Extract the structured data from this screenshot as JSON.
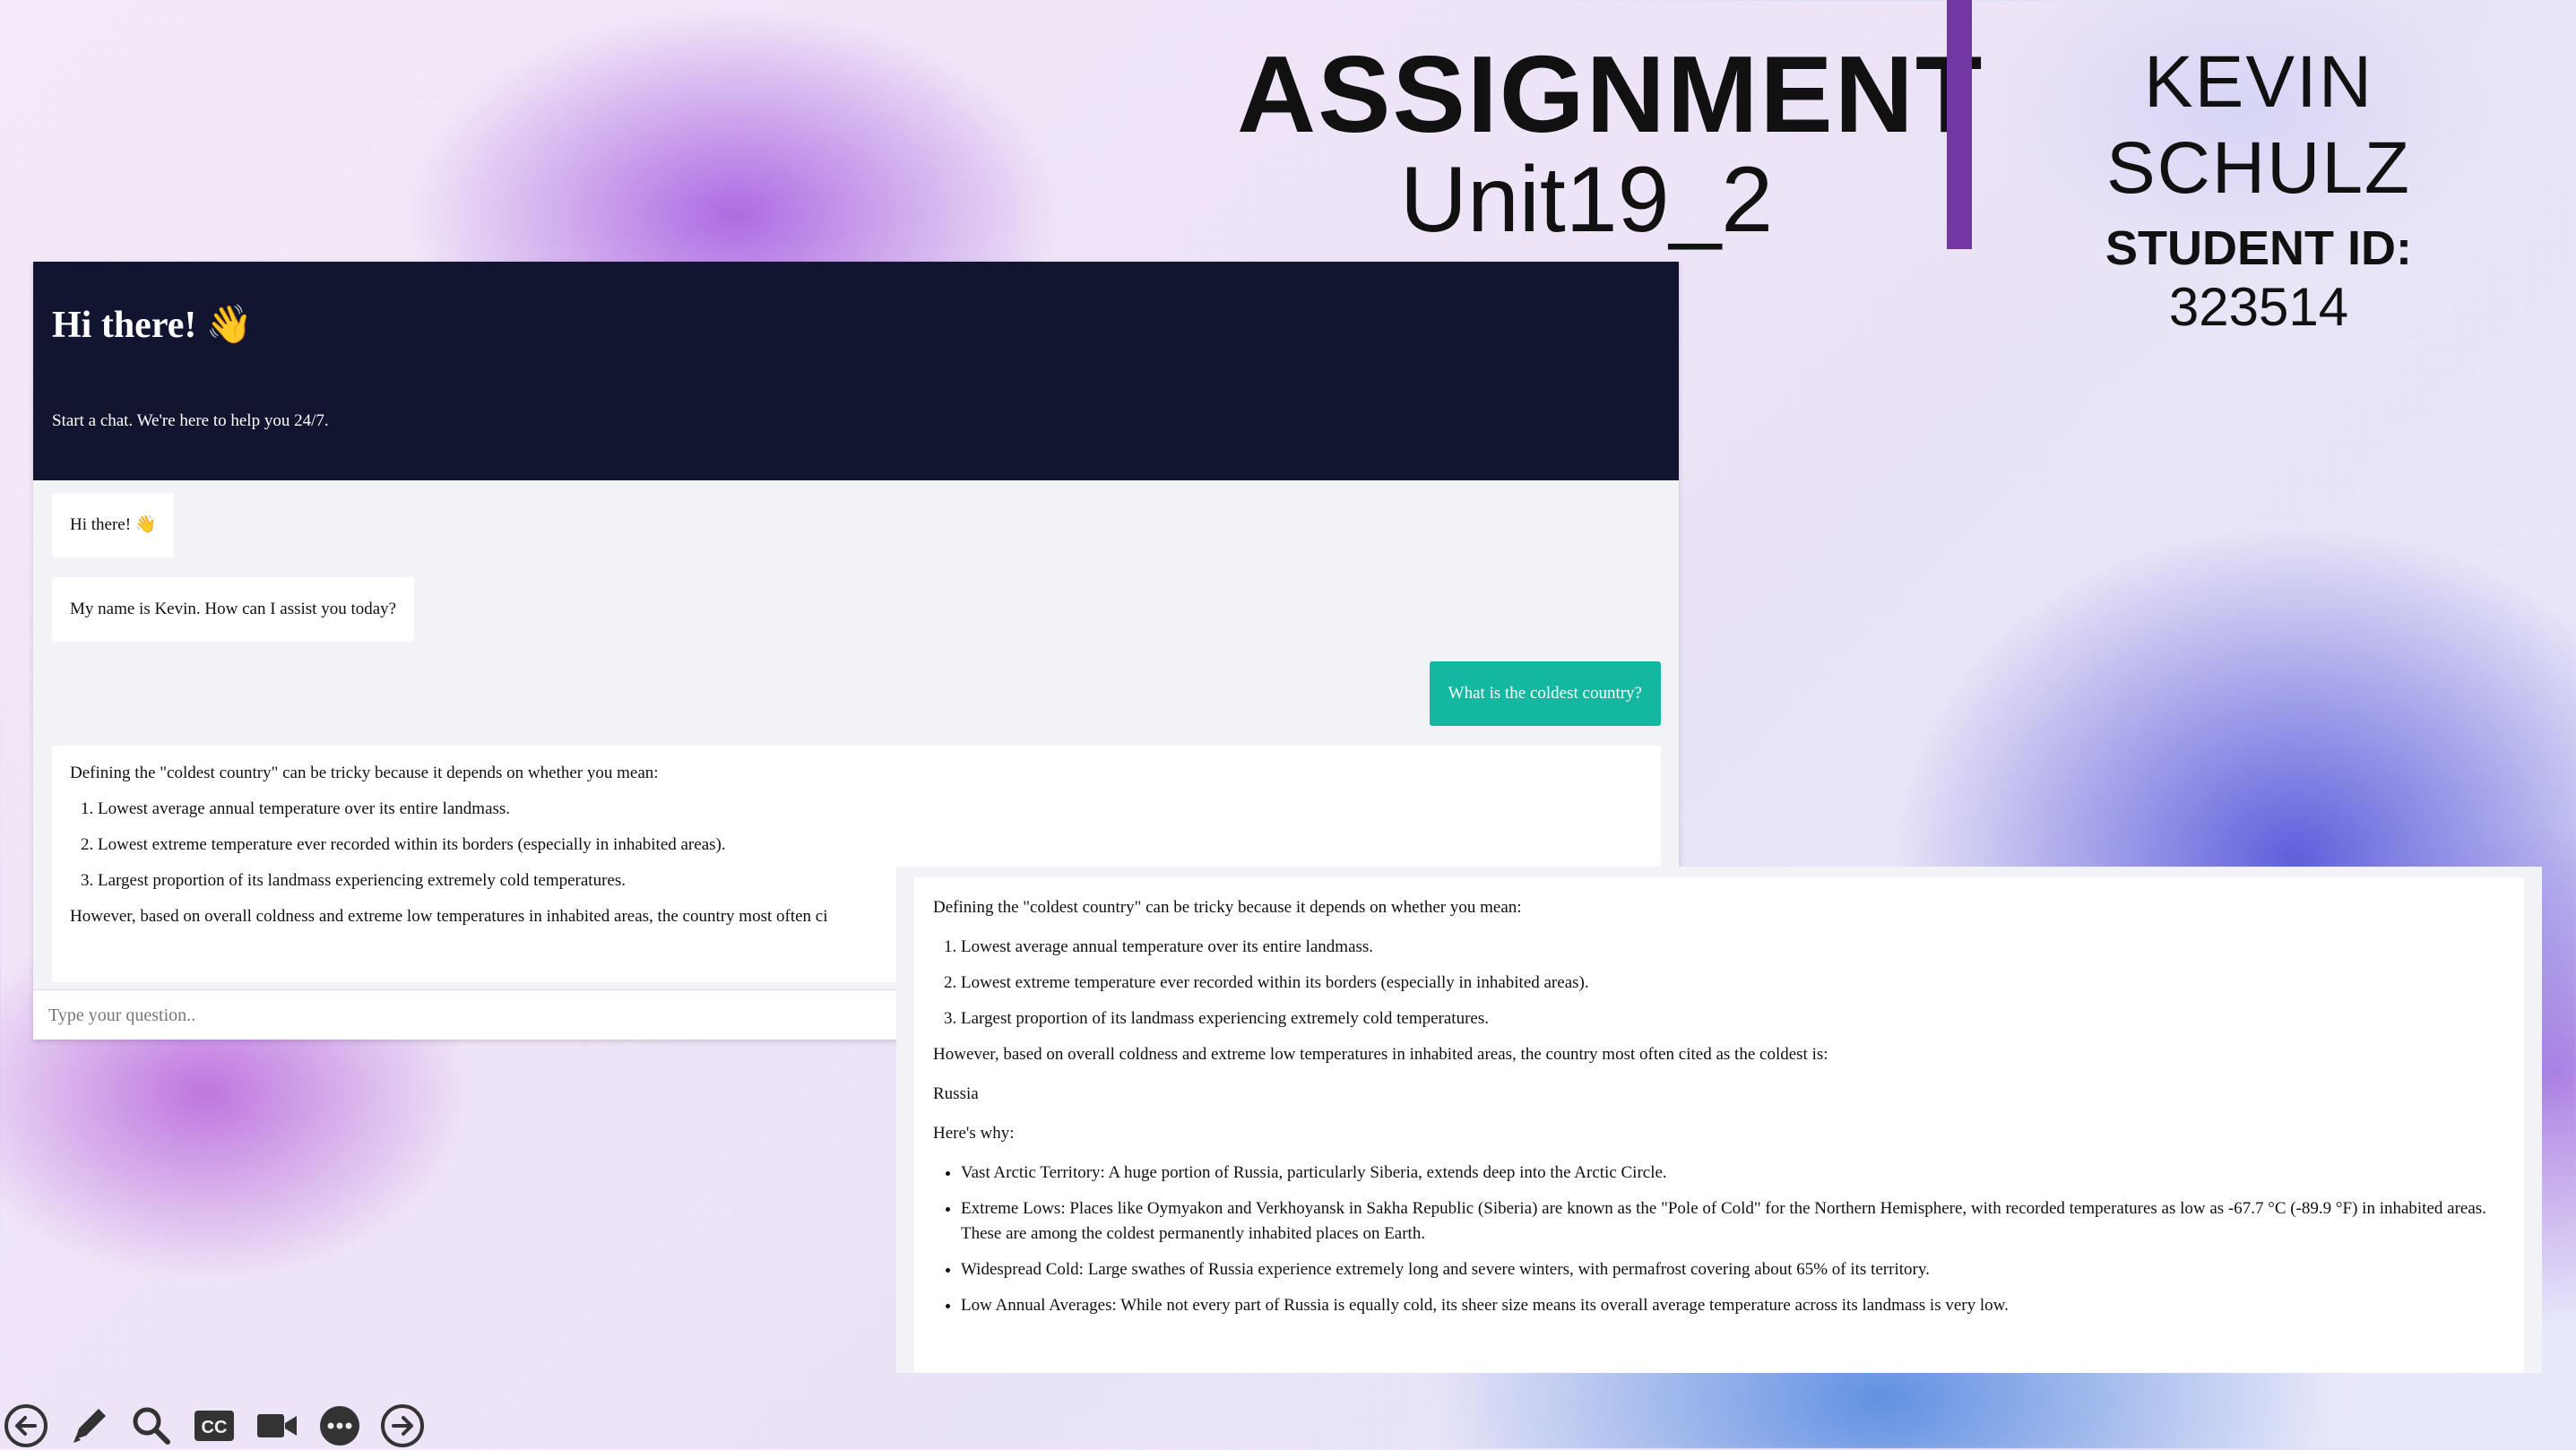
{
  "slide": {
    "title": "ASSIGNMENT",
    "subtitle": "Unit19_2",
    "student_name": "KEVIN SCHULZ",
    "student_id_label": "STUDENT ID:",
    "student_id": "323514",
    "accent_color": "#7337a3"
  },
  "chat": {
    "header_title": "Hi there! 👋",
    "header_subtitle": "Start a chat. We're here to help you 24/7.",
    "bot_greeting": "Hi there! 👋",
    "bot_intro": "My name is Kevin. How can I assist you today?",
    "user_question": "What is the coldest country?",
    "answer_intro": "Defining the \"coldest country\" can be tricky because it depends on whether you mean:",
    "answer_criteria": [
      "Lowest average annual temperature over its entire landmass.",
      "Lowest extreme temperature ever recorded within its borders (especially in inhabited areas).",
      "Largest proportion of its landmass experiencing extremely cold temperatures."
    ],
    "answer_lead_truncated": "However, based on overall coldness and extreme low temperatures in inhabited areas, the country most often ci",
    "input_placeholder": "Type your question..",
    "header_color": "#121530",
    "user_bubble_color": "#14b7a0"
  },
  "zoom": {
    "intro": "Defining the \"coldest country\" can be tricky because it depends on whether you mean:",
    "criteria": [
      "Lowest average annual temperature over its entire landmass.",
      "Lowest extreme temperature ever recorded within its borders (especially in inhabited areas).",
      "Largest proportion of its landmass experiencing extremely cold temperatures."
    ],
    "lead": "However, based on overall coldness and extreme low temperatures in inhabited areas, the country most often cited as the coldest is:",
    "country": "Russia",
    "why": "Here's why:",
    "reasons": [
      "Vast Arctic Territory: A huge portion of Russia, particularly Siberia, extends deep into the Arctic Circle.",
      "Extreme Lows: Places like Oymyakon and Verkhoyansk in Sakha Republic (Siberia) are known as the \"Pole of Cold\" for the Northern Hemisphere, with recorded temperatures as low as -67.7 °C (-89.9 °F) in inhabited areas. These are among the coldest permanently inhabited places on Earth.",
      "Widespread Cold: Large swathes of Russia experience extremely long and severe winters, with permafrost covering about 65% of its territory.",
      "Low Annual Averages: While not every part of Russia is equally cold, its sheer size means its overall average temperature across its landmass is very low."
    ]
  },
  "toolbar": {
    "icons": [
      "back-arrow-icon",
      "pen-icon",
      "zoom-icon",
      "closed-captions-icon",
      "camera-icon",
      "more-icon",
      "forward-arrow-icon"
    ]
  }
}
